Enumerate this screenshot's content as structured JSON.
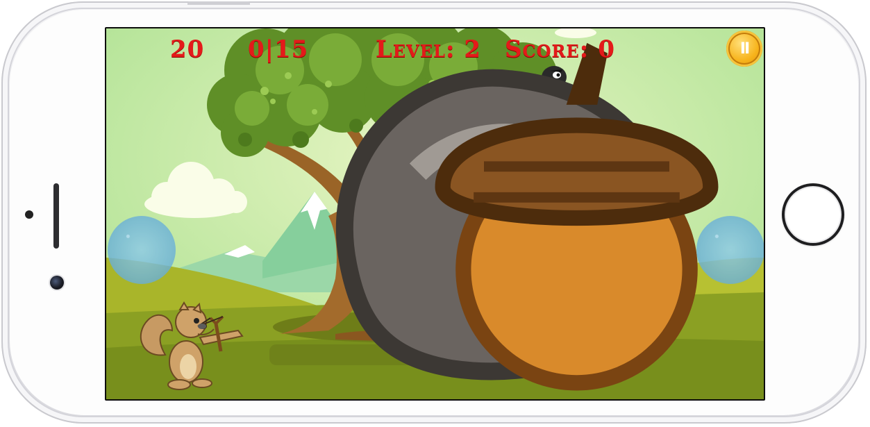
{
  "device": {
    "type": "phone",
    "orientation": "landscape"
  },
  "hud": {
    "stones_count": "20",
    "stone_icon": "stone-icon",
    "acorns_progress": "0|15",
    "acorn_icon": "acorn-icon",
    "level_text": "Level: 2",
    "score_text": "Score: 0",
    "pause_glyph": "II",
    "pause_icon": "pause-icon"
  },
  "scene": {
    "characters": [
      "squirrel-with-slingshot",
      "crow"
    ],
    "background": [
      "tree",
      "clouds",
      "mountains",
      "hills"
    ]
  },
  "colors": {
    "hud_text": "#e41a1a",
    "sky_light": "#dff2b8",
    "sky_dark": "#a9e18f",
    "grass": "#8aa22a",
    "pause_button": "#f7b31b"
  }
}
